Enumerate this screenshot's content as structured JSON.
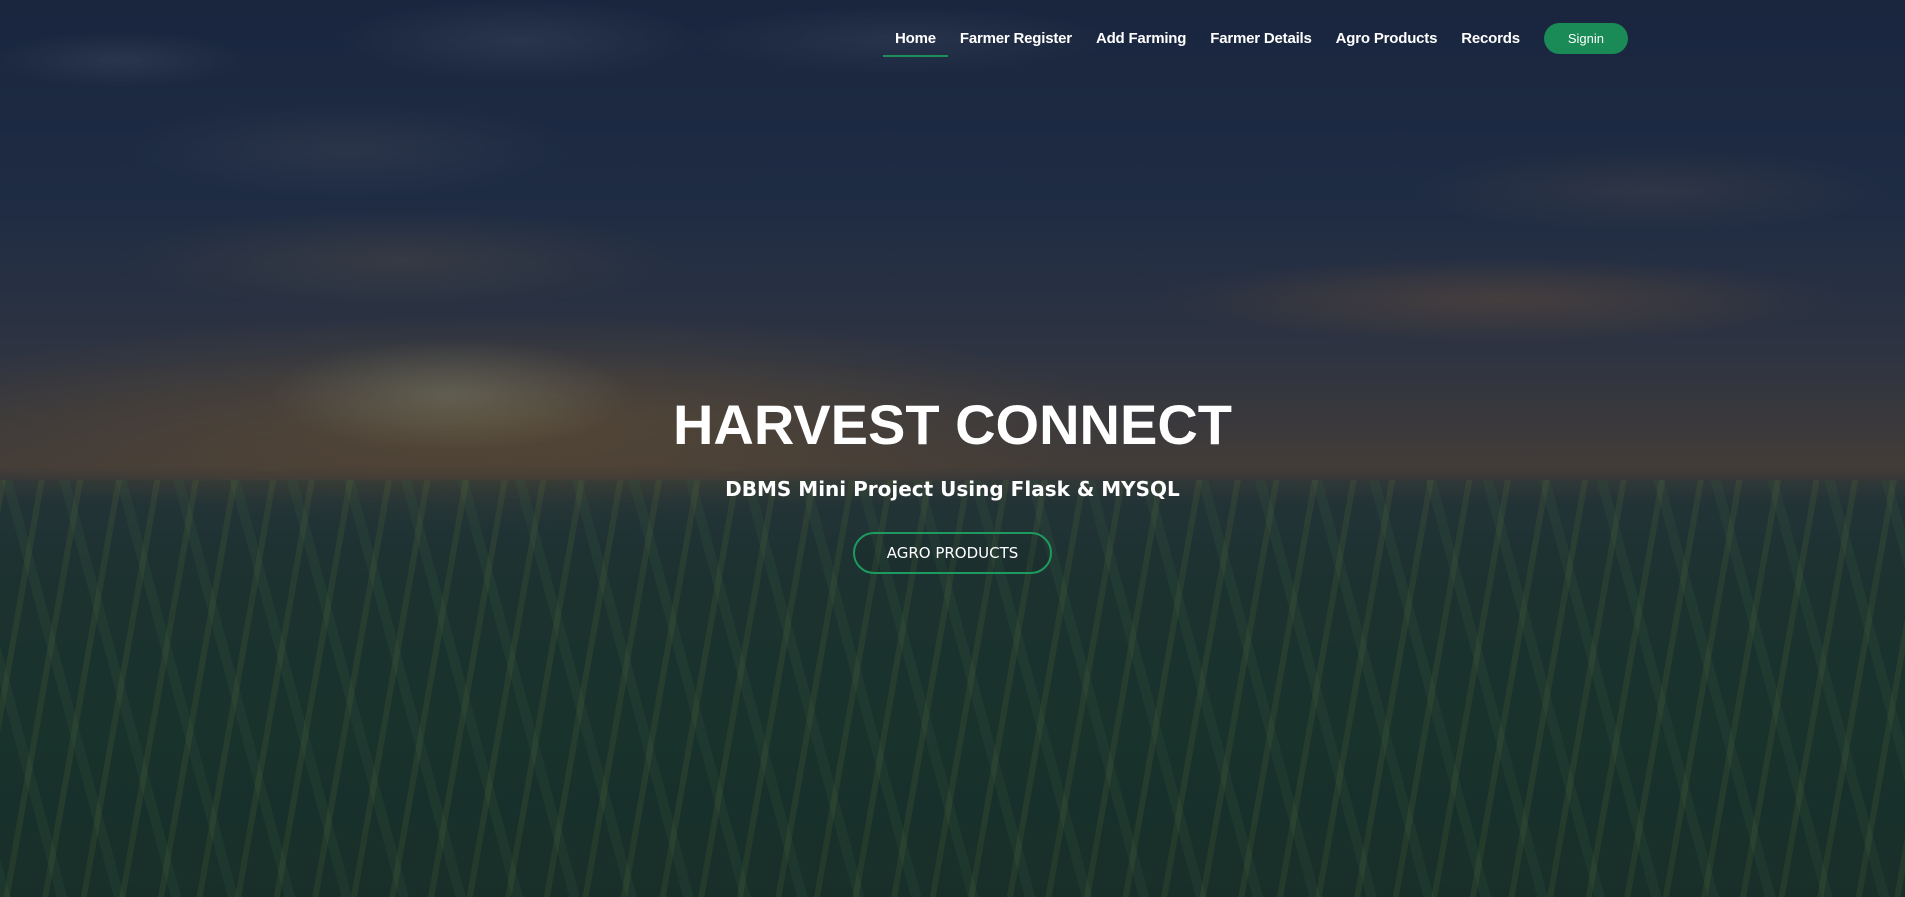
{
  "nav": {
    "links": [
      {
        "label": "Home",
        "active": true
      },
      {
        "label": "Farmer Register",
        "active": false
      },
      {
        "label": "Add Farming",
        "active": false
      },
      {
        "label": "Farmer Details",
        "active": false
      },
      {
        "label": "Agro Products",
        "active": false
      },
      {
        "label": "Records",
        "active": false
      }
    ],
    "signin_label": "Signin"
  },
  "hero": {
    "title": "HARVEST CONNECT",
    "subtitle": "DBMS Mini Project Using Flask & MYSQL",
    "cta_label": "AGRO PRODUCTS"
  },
  "colors": {
    "accent": "#1a8a56",
    "text": "#ffffff"
  }
}
